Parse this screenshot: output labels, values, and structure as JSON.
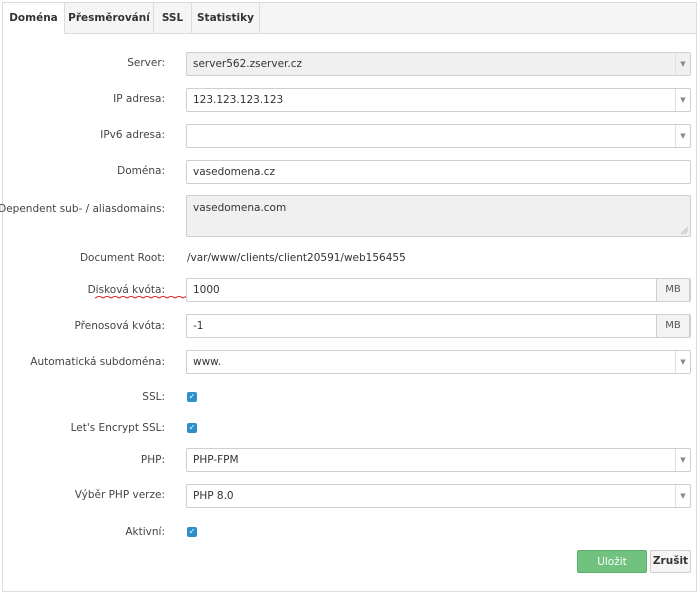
{
  "tabs": [
    "Doména",
    "Přesměrování",
    "SSL",
    "Statistiky"
  ],
  "form": {
    "server": {
      "label": "Server:",
      "value": "server562.zserver.cz"
    },
    "ip": {
      "label": "IP adresa:",
      "value": "123.123.123.123"
    },
    "ipv6": {
      "label": "IPv6 adresa:",
      "value": ""
    },
    "domain": {
      "label": "Doména:",
      "value": "vasedomena.cz"
    },
    "aliases": {
      "label": "Dependent sub- / aliasdomains:",
      "value": "vasedomena.com"
    },
    "docroot": {
      "label": "Document Root:",
      "value": "/var/www/clients/client20591/web156455"
    },
    "quota": {
      "label": "Disková kvóta:",
      "value": "1000",
      "unit": "MB"
    },
    "traffic": {
      "label": "Přenosová kvóta:",
      "value": "-1",
      "unit": "MB"
    },
    "subdomain": {
      "label": "Automatická subdoména:",
      "value": "www."
    },
    "ssl": {
      "label": "SSL:",
      "checked": true
    },
    "letsencrypt": {
      "label": "Let's Encrypt SSL:",
      "checked": true
    },
    "php": {
      "label": "PHP:",
      "value": "PHP-FPM"
    },
    "phpver": {
      "label": "Výběr PHP verze:",
      "value": "PHP 8.0"
    },
    "active": {
      "label": "Aktivní:",
      "checked": true
    }
  },
  "buttons": {
    "save": "Uložit",
    "cancel": "Zrušit"
  },
  "colors": {
    "accent": "#2e8fcf",
    "save": "#71c17f",
    "spellcheck": "#e02020"
  }
}
